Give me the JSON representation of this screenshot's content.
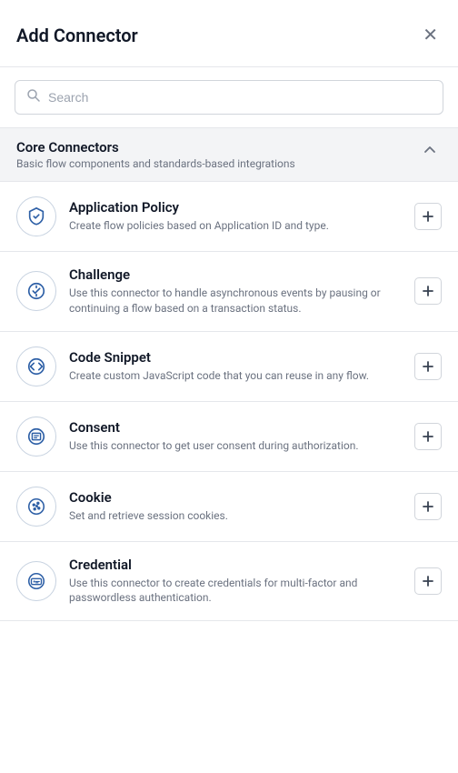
{
  "header": {
    "title": "Add Connector",
    "close_label": "✕"
  },
  "search": {
    "placeholder": "Search"
  },
  "section": {
    "title": "Core Connectors",
    "subtitle": "Basic flow components and standards-based integrations",
    "chevron": "⌃"
  },
  "connectors": [
    {
      "id": "application-policy",
      "name": "Application Policy",
      "description": "Create flow policies based on Application ID and type.",
      "icon": "shield"
    },
    {
      "id": "challenge",
      "name": "Challenge",
      "description": "Use this connector to handle asynchronous events by pausing or continuing a flow based on a transaction status.",
      "icon": "activity"
    },
    {
      "id": "code-snippet",
      "name": "Code Snippet",
      "description": "Create custom JavaScript code that you can reuse in any flow.",
      "icon": "code"
    },
    {
      "id": "consent",
      "name": "Consent",
      "description": "Use this connector to get user consent during authorization.",
      "icon": "document"
    },
    {
      "id": "cookie",
      "name": "Cookie",
      "description": "Set and retrieve session cookies.",
      "icon": "cookie"
    },
    {
      "id": "credential",
      "name": "Credential",
      "description": "Use this connector to create credentials for multi-factor and passwordless authentication.",
      "icon": "credential"
    }
  ]
}
